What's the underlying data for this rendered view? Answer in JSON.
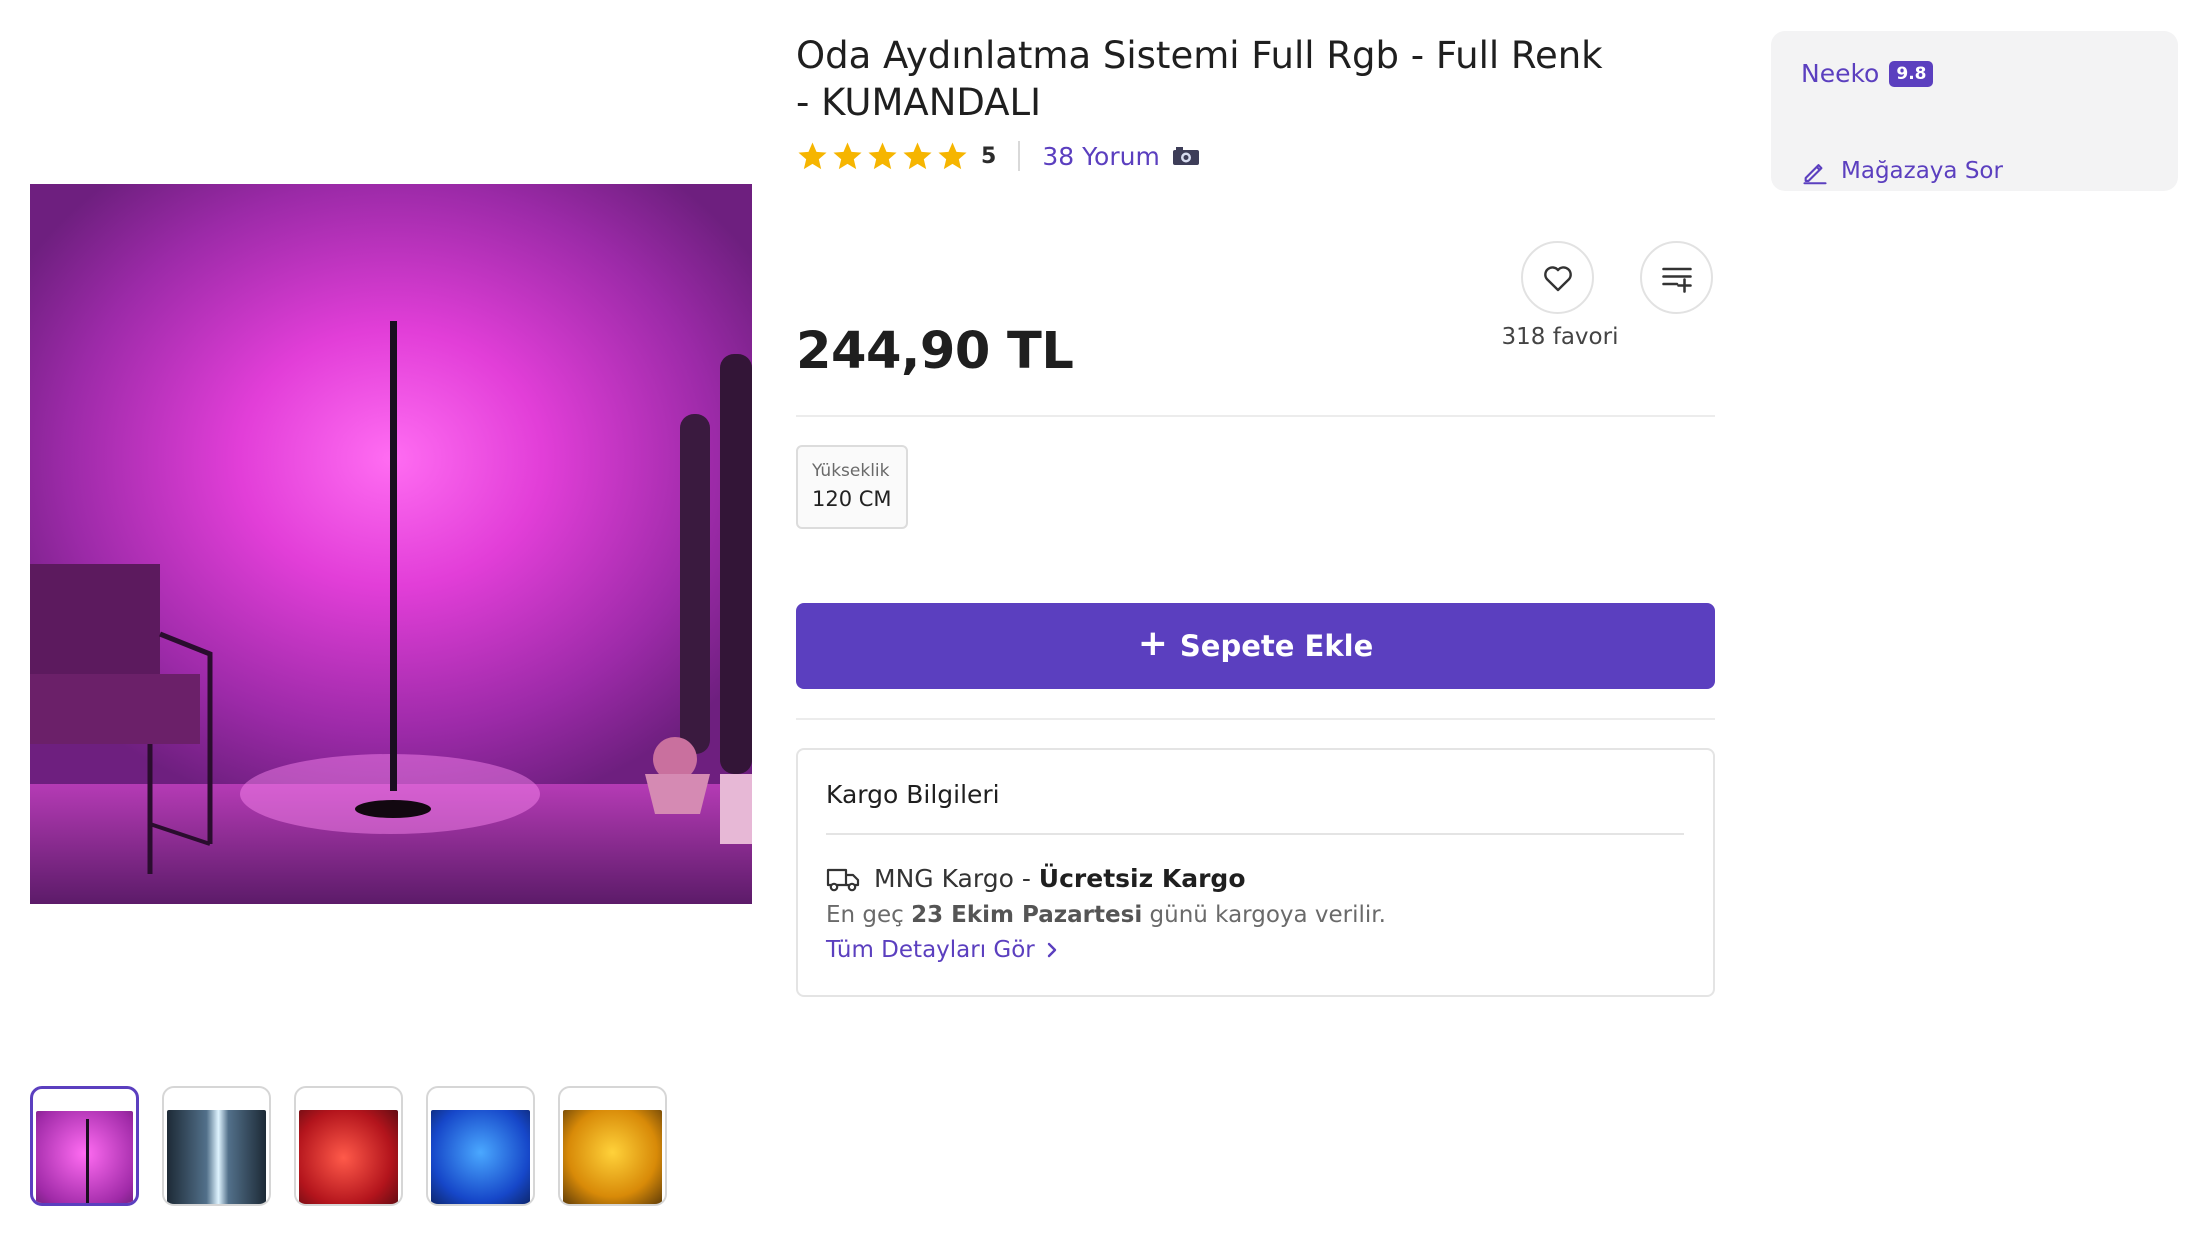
{
  "product": {
    "title": "Oda Aydınlatma Sistemi Full Rgb - Full Renk - KUMANDALI",
    "rating": "5",
    "star_count": 5,
    "star_color": "#f6b500",
    "review_text": "38 Yorum",
    "price": "244,90 TL",
    "favorites_text": "318 favori"
  },
  "variant": {
    "label": "Yükseklik",
    "value": "120 CM"
  },
  "cart": {
    "plus_symbol": "+",
    "add_label": "Sepete Ekle"
  },
  "shipping": {
    "title": "Kargo Bilgileri",
    "carrier": "MNG Kargo",
    "separator": " - ",
    "free_label": "Ücretsiz Kargo",
    "date_prefix": "En geç",
    "date": "23 Ekim Pazartesi",
    "date_suffix": "günü kargoya verilir.",
    "details_link": "Tüm Detayları Gör"
  },
  "seller": {
    "name": "Neeko",
    "score": "9.8",
    "ask_label": "Mağazaya Sor"
  },
  "thumbnails": [
    {
      "scene": "pink-lamp",
      "active": true
    },
    {
      "scene": "white-lamp",
      "active": false
    },
    {
      "scene": "red-room",
      "active": false
    },
    {
      "scene": "blue-lamp",
      "active": false
    },
    {
      "scene": "yellow-room",
      "active": false
    }
  ],
  "colors": {
    "accent": "#5b3fbf",
    "star": "#f6b500"
  },
  "icons": [
    "heart-icon",
    "add-to-list-icon",
    "truck-icon",
    "edit-icon",
    "camera-icon",
    "chevron-right-icon",
    "star-icon"
  ]
}
